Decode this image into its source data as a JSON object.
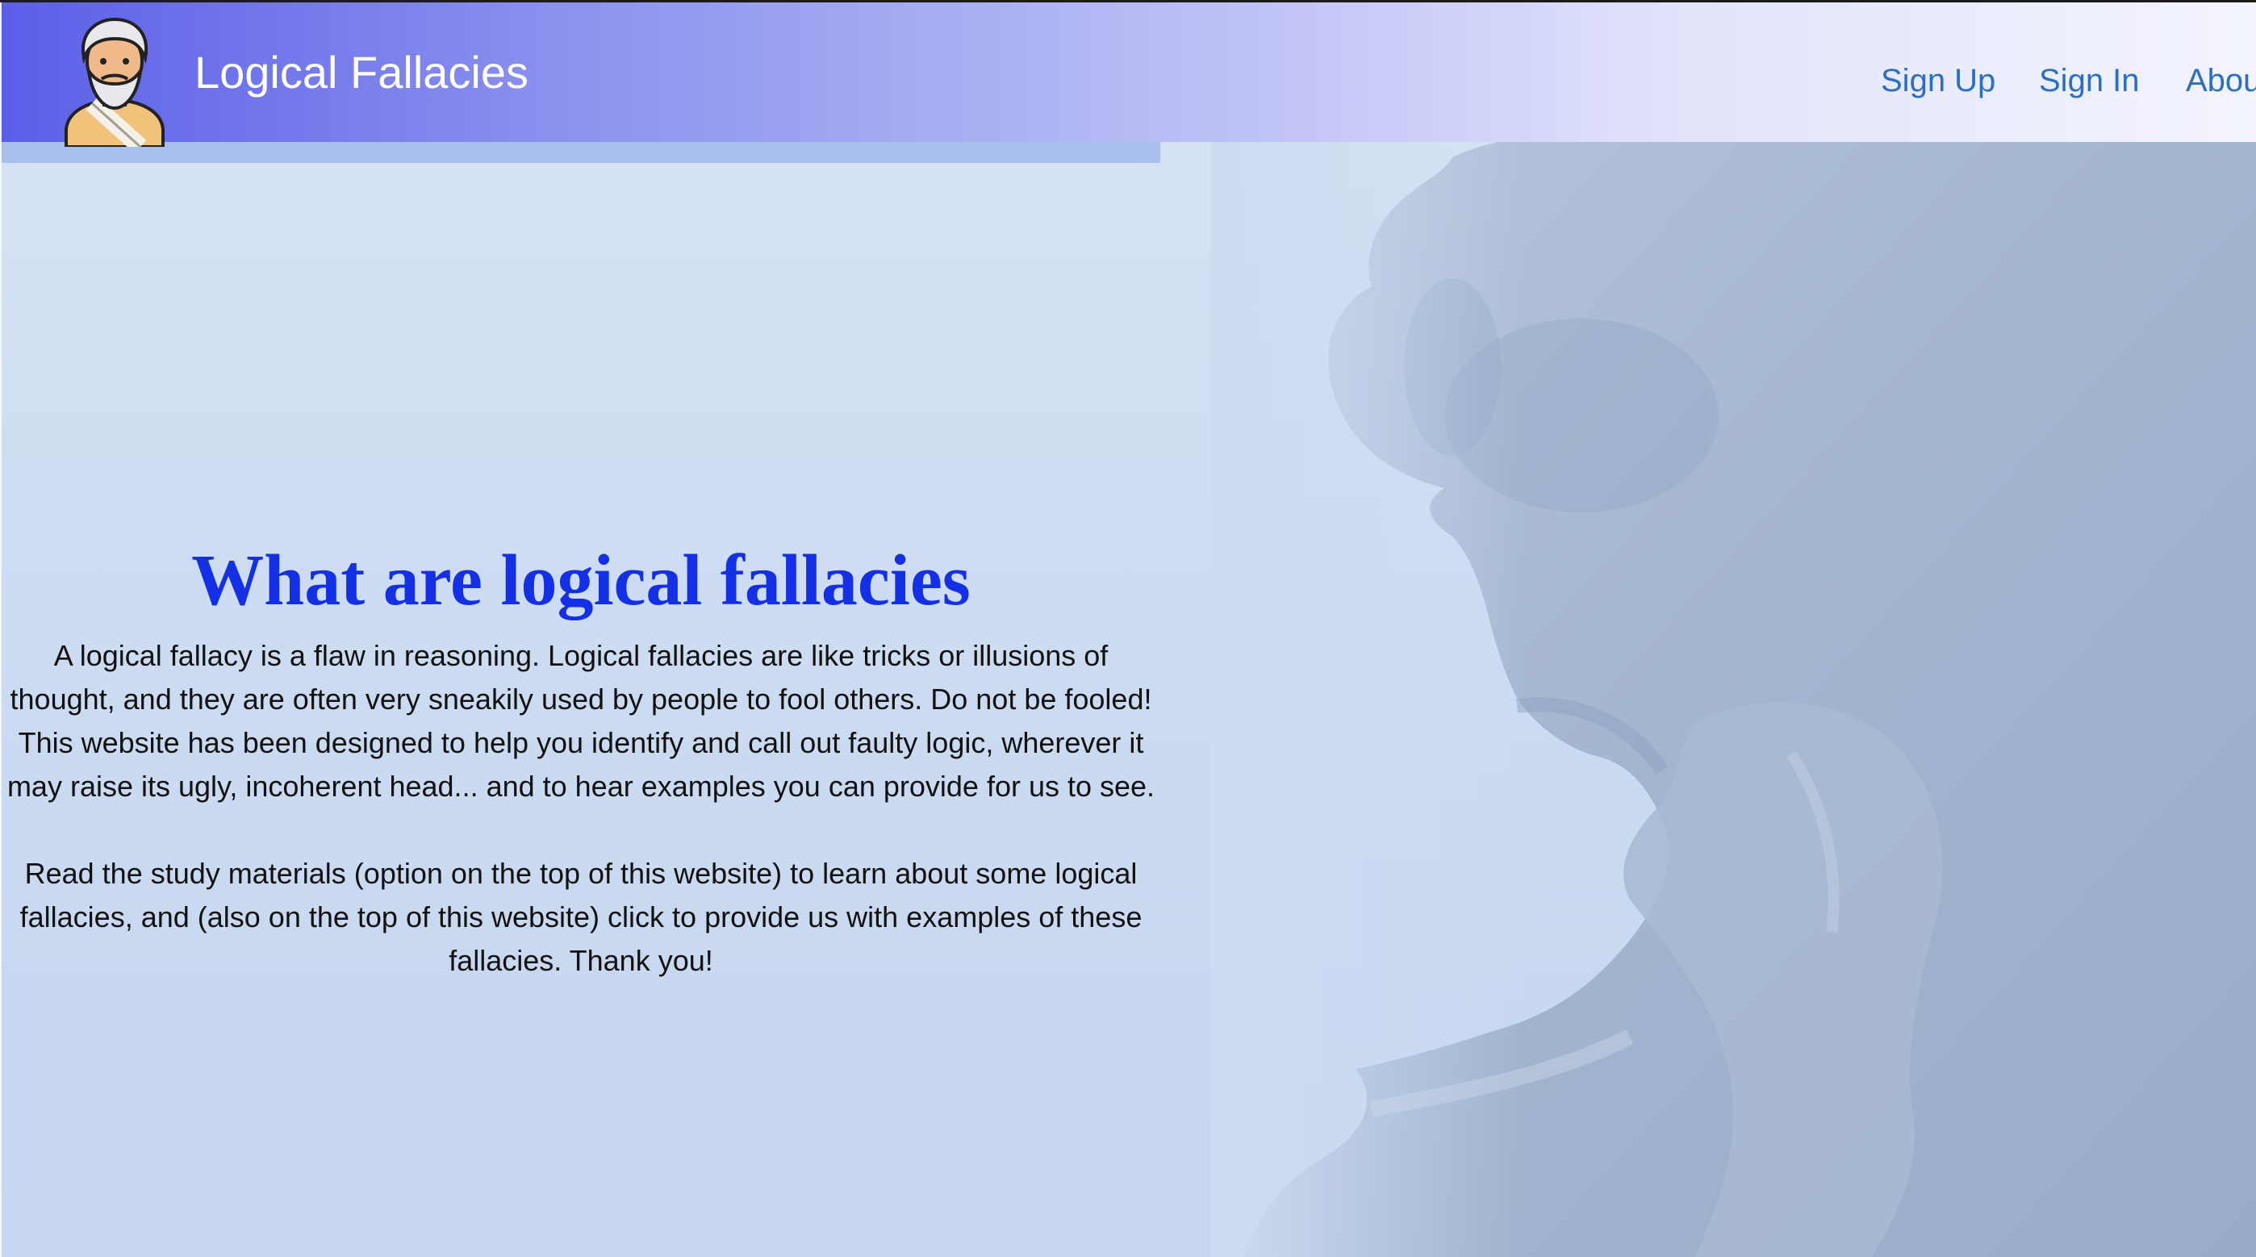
{
  "header": {
    "title": "Logical Fallacies",
    "logo_icon": "philosopher-avatar-icon",
    "nav": {
      "sign_up": "Sign Up",
      "sign_in": "Sign In",
      "about": "Abou"
    }
  },
  "main": {
    "headline": "What are logical fallacies",
    "paragraph1": "A logical fallacy is a flaw in reasoning. Logical fallacies are like tricks or illusions of thought, and they are often very sneakily used by people to fool others. Do not be fooled! This website has been designed to help you identify and call out faulty logic, wherever it may raise its ugly, incoherent head... and to hear examples you can provide for us to see.",
    "paragraph2": "Read the study materials (option on the top of this website) to learn about some logical fallacies, and (also on the top of this website) click to provide us with examples of these fallacies. Thank you!"
  },
  "background": {
    "image": "thinker-statue-illustration"
  },
  "colors": {
    "headline": "#1330e6",
    "nav_link": "#2a6fc4",
    "header_start": "#5b5fe8",
    "header_end": "#f3f4fd",
    "page_background": "#ccdcf2"
  }
}
